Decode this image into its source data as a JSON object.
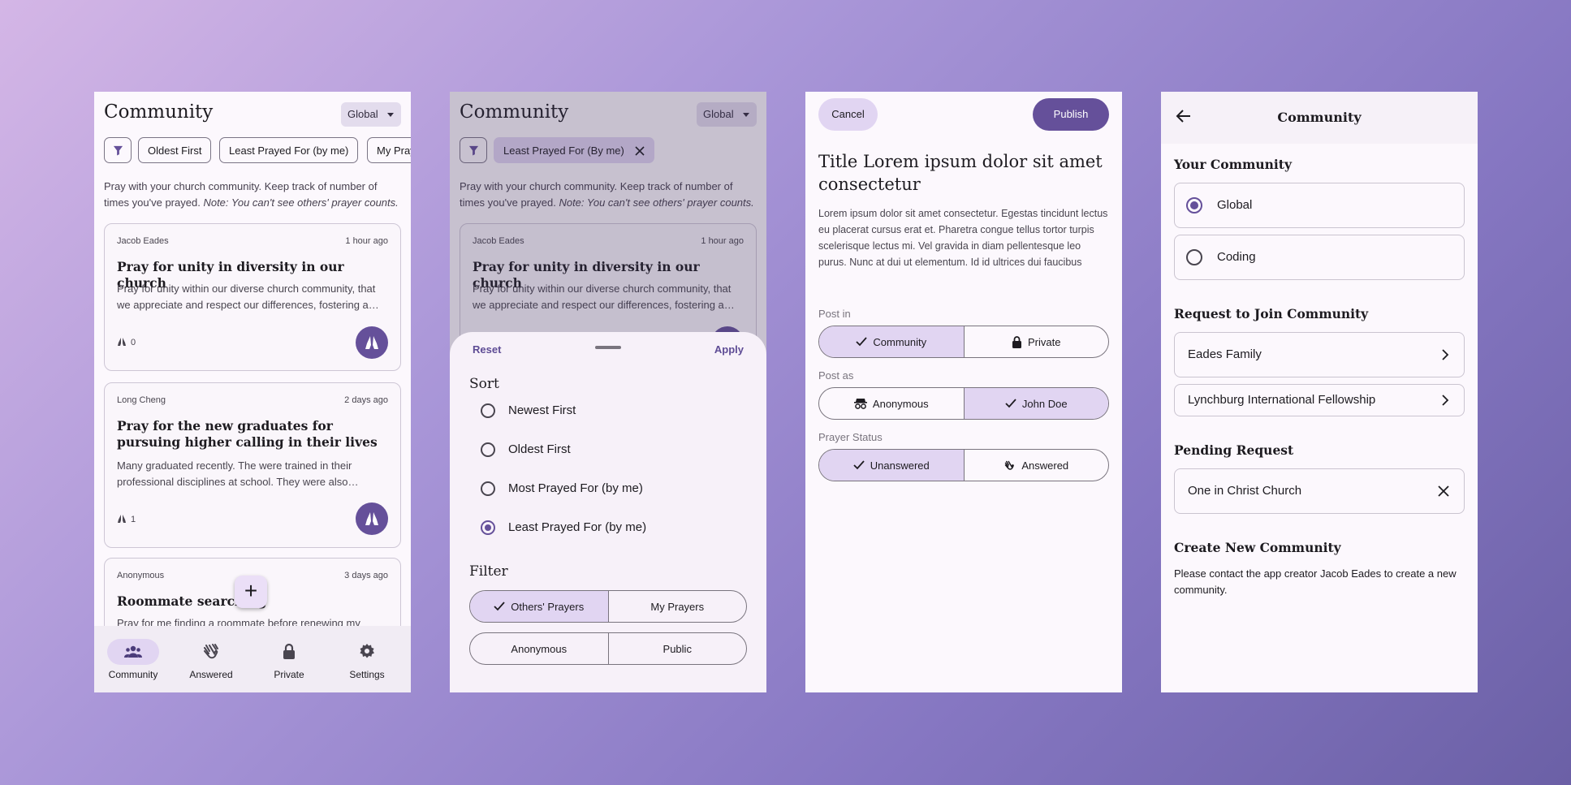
{
  "screen1": {
    "title": "Community",
    "community_select": "Global",
    "chips": [
      "Oldest First",
      "Least Prayed For (by me)",
      "My Prayers"
    ],
    "intro": "Pray with your church community. Keep track of number of times you've prayed.",
    "intro_note": "Note: You can't see others' prayer counts.",
    "cards": [
      {
        "author": "Jacob Eades",
        "time": "1 hour ago",
        "title": "Pray for unity in diversity in our church",
        "body": "Pray for unity within our diverse church community, that we appreciate and respect our differences, fostering a…",
        "count": "0"
      },
      {
        "author": "Long Cheng",
        "time": "2 days ago",
        "title": "Pray for the new graduates for pursuing higher calling in their lives",
        "body": "Many graduated recently. The were trained in their professional disciplines at school. They were also…",
        "count": "1"
      },
      {
        "author": "Anonymous",
        "time": "3 days ago",
        "title": "Roommate searching",
        "body": "Pray for me finding a roommate before renewing my"
      }
    ],
    "nav": [
      {
        "label": "Community",
        "icon": "group-icon",
        "active": true
      },
      {
        "label": "Answered",
        "icon": "clapping-hands-icon"
      },
      {
        "label": "Private",
        "icon": "lock-icon"
      },
      {
        "label": "Settings",
        "icon": "gear-icon"
      }
    ]
  },
  "screen2": {
    "title": "Community",
    "community_select": "Global",
    "active_chip": "Least Prayed For (By me)",
    "intro": "Pray with your church community. Keep track of number of times you've prayed.",
    "intro_note": "Note: You can't see others' prayer counts.",
    "card": {
      "author": "Jacob Eades",
      "time": "1 hour ago",
      "title": "Pray for unity in diversity in our church",
      "body": "Pray for unity within our diverse church community, that we appreciate and respect our differences, fostering a…"
    },
    "sheet": {
      "reset": "Reset",
      "apply": "Apply",
      "sort_heading": "Sort",
      "sort_options": [
        "Newest First",
        "Oldest First",
        "Most Prayed For (by me)",
        "Least Prayed For (by me)"
      ],
      "sort_selected_index": 3,
      "filter_heading": "Filter",
      "filter_row1": [
        "Others' Prayers",
        "My Prayers"
      ],
      "filter_row2": [
        "Anonymous",
        "Public"
      ]
    }
  },
  "screen3": {
    "cancel": "Cancel",
    "publish": "Publish",
    "title": "Title Lorem ipsum dolor sit amet consectetur",
    "body": "Lorem ipsum dolor sit amet consectetur. Egestas tincidunt lectus eu placerat cursus erat et. Pharetra congue tellus tortor turpis scelerisque lectus mi. Vel gravida in diam pellentesque leo purus. Nunc at dui ut elementum. Id id ultrices dui faucibus",
    "post_in_label": "Post in",
    "post_in": [
      "Community",
      "Private"
    ],
    "post_as_label": "Post as",
    "post_as": [
      "Anonymous",
      "John Doe"
    ],
    "status_label": "Prayer Status",
    "status": [
      "Unanswered",
      "Answered"
    ]
  },
  "screen4": {
    "title": "Community",
    "your_heading": "Your Community",
    "your_options": [
      "Global",
      "Coding"
    ],
    "request_heading": "Request to Join Community",
    "request_options": [
      "Eades Family",
      "Lynchburg International Fellowship"
    ],
    "pending_heading": "Pending Request",
    "pending": "One in Christ Church",
    "create_heading": "Create New Community",
    "create_note": "Please contact the app creator Jacob Eades to create a new community."
  },
  "colors": {
    "accent": "#65509a",
    "selected": "#e1d5f2",
    "surface": "#fcf8fd"
  }
}
